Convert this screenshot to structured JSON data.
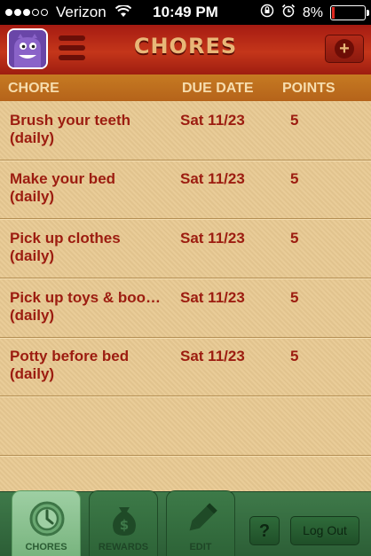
{
  "status_bar": {
    "carrier": "Verizon",
    "time": "10:49 PM",
    "battery": "8%",
    "battery_level": 0.08,
    "signal_bars_filled": 3,
    "signal_bars_total": 5
  },
  "header": {
    "title": "CHORES",
    "add_icon": "+"
  },
  "columns": {
    "chore": "CHORE",
    "due_date": "DUE DATE",
    "points": "POINTS"
  },
  "chores": [
    {
      "name": "Brush your teeth",
      "frequency": "(daily)",
      "due": "Sat 11/23",
      "points": "5"
    },
    {
      "name": "Make your bed",
      "frequency": "(daily)",
      "due": "Sat 11/23",
      "points": "5"
    },
    {
      "name": "Pick up clothes",
      "frequency": "(daily)",
      "due": "Sat 11/23",
      "points": "5"
    },
    {
      "name": "Pick up toys & boo…",
      "frequency": "(daily)",
      "due": "Sat 11/23",
      "points": "5"
    },
    {
      "name": "Potty before bed",
      "frequency": "(daily)",
      "due": "Sat 11/23",
      "points": "5"
    }
  ],
  "tabs": [
    {
      "label": "CHORES",
      "icon": "clock-icon",
      "active": true
    },
    {
      "label": "REWARDS",
      "icon": "money-bag-icon",
      "active": false
    },
    {
      "label": "EDIT",
      "icon": "pencil-icon",
      "active": false
    }
  ],
  "toolbar": {
    "help_label": "?",
    "logout_label": "Log Out"
  },
  "colors": {
    "header_red": "#a51b12",
    "title_tan": "#e8b778",
    "column_header_orange": "#c67a22",
    "row_text_red": "#9c1c10",
    "tab_green": "#3f7a4a",
    "active_tab_green": "#9ecfa3"
  }
}
